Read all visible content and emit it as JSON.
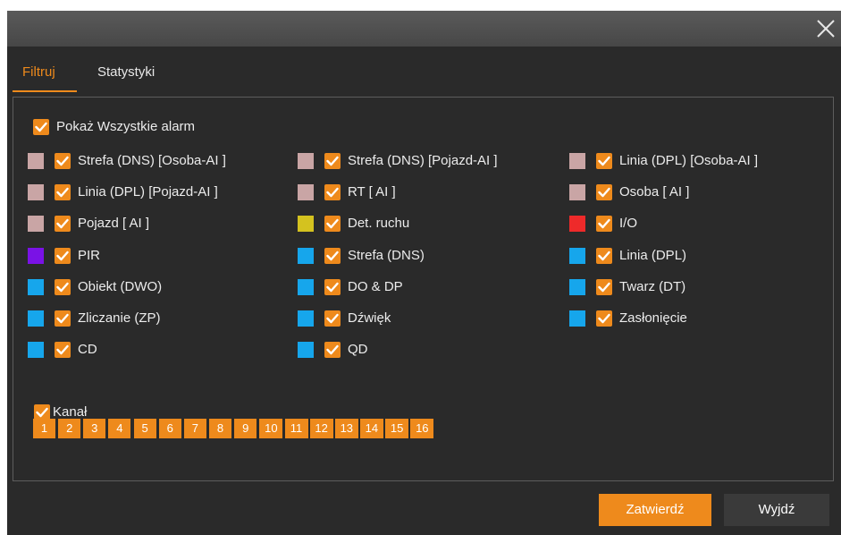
{
  "tabs": [
    "Filtruj",
    "Statystyki"
  ],
  "show_all": {
    "label": "Pokaż Wszystkie alarm",
    "checked": true
  },
  "alarm_types": [
    [
      {
        "label": "Strefa (DNS) [Osoba-AI ]",
        "color": "#c9a5a5",
        "checked": true
      },
      {
        "label": "Strefa (DNS) [Pojazd-AI ]",
        "color": "#c9a5a5",
        "checked": true
      },
      {
        "label": "Linia (DPL) [Osoba-AI ]",
        "color": "#c9a5a5",
        "checked": true
      }
    ],
    [
      {
        "label": "Linia (DPL) [Pojazd-AI ]",
        "color": "#c9a5a5",
        "checked": true
      },
      {
        "label": "RT  [ AI ]",
        "color": "#c9a5a5",
        "checked": true
      },
      {
        "label": "Osoba  [ AI ]",
        "color": "#c9a5a5",
        "checked": true
      }
    ],
    [
      {
        "label": "Pojazd  [ AI ]",
        "color": "#c9a5a5",
        "checked": true
      },
      {
        "label": "Det. ruchu",
        "color": "#d4c21f",
        "checked": true
      },
      {
        "label": "I/O",
        "color": "#ee2a2a",
        "checked": true
      }
    ],
    [
      {
        "label": "PIR",
        "color": "#7a12e6",
        "checked": true
      },
      {
        "label": "Strefa (DNS)",
        "color": "#16a6ec",
        "checked": true
      },
      {
        "label": "Linia (DPL)",
        "color": "#16a6ec",
        "checked": true
      }
    ],
    [
      {
        "label": "Obiekt (DWO)",
        "color": "#16a6ec",
        "checked": true
      },
      {
        "label": "DO & DP",
        "color": "#16a6ec",
        "checked": true
      },
      {
        "label": "Twarz (DT)",
        "color": "#16a6ec",
        "checked": true
      }
    ],
    [
      {
        "label": "Zliczanie (ZP)",
        "color": "#16a6ec",
        "checked": true
      },
      {
        "label": "Dźwięk",
        "color": "#16a6ec",
        "checked": true
      },
      {
        "label": "Zasłonięcie",
        "color": "#16a6ec",
        "checked": true
      }
    ],
    [
      {
        "label": "CD",
        "color": "#16a6ec",
        "checked": true
      },
      {
        "label": "QD",
        "color": "#16a6ec",
        "checked": true
      }
    ]
  ],
  "channel": {
    "label": "Kanał",
    "checked": true,
    "numbers": [
      "1",
      "2",
      "3",
      "4",
      "5",
      "6",
      "7",
      "8",
      "9",
      "10",
      "11",
      "12",
      "13",
      "14",
      "15",
      "16"
    ]
  },
  "buttons": {
    "confirm": "Zatwierdź",
    "exit": "Wyjdź"
  },
  "colors": {
    "accent": "#ee8a1c",
    "background": "#2a2a2a",
    "titlebar": "#4f4f4f"
  },
  "icons": {
    "close": "close-icon",
    "check": "checkmark-icon"
  }
}
